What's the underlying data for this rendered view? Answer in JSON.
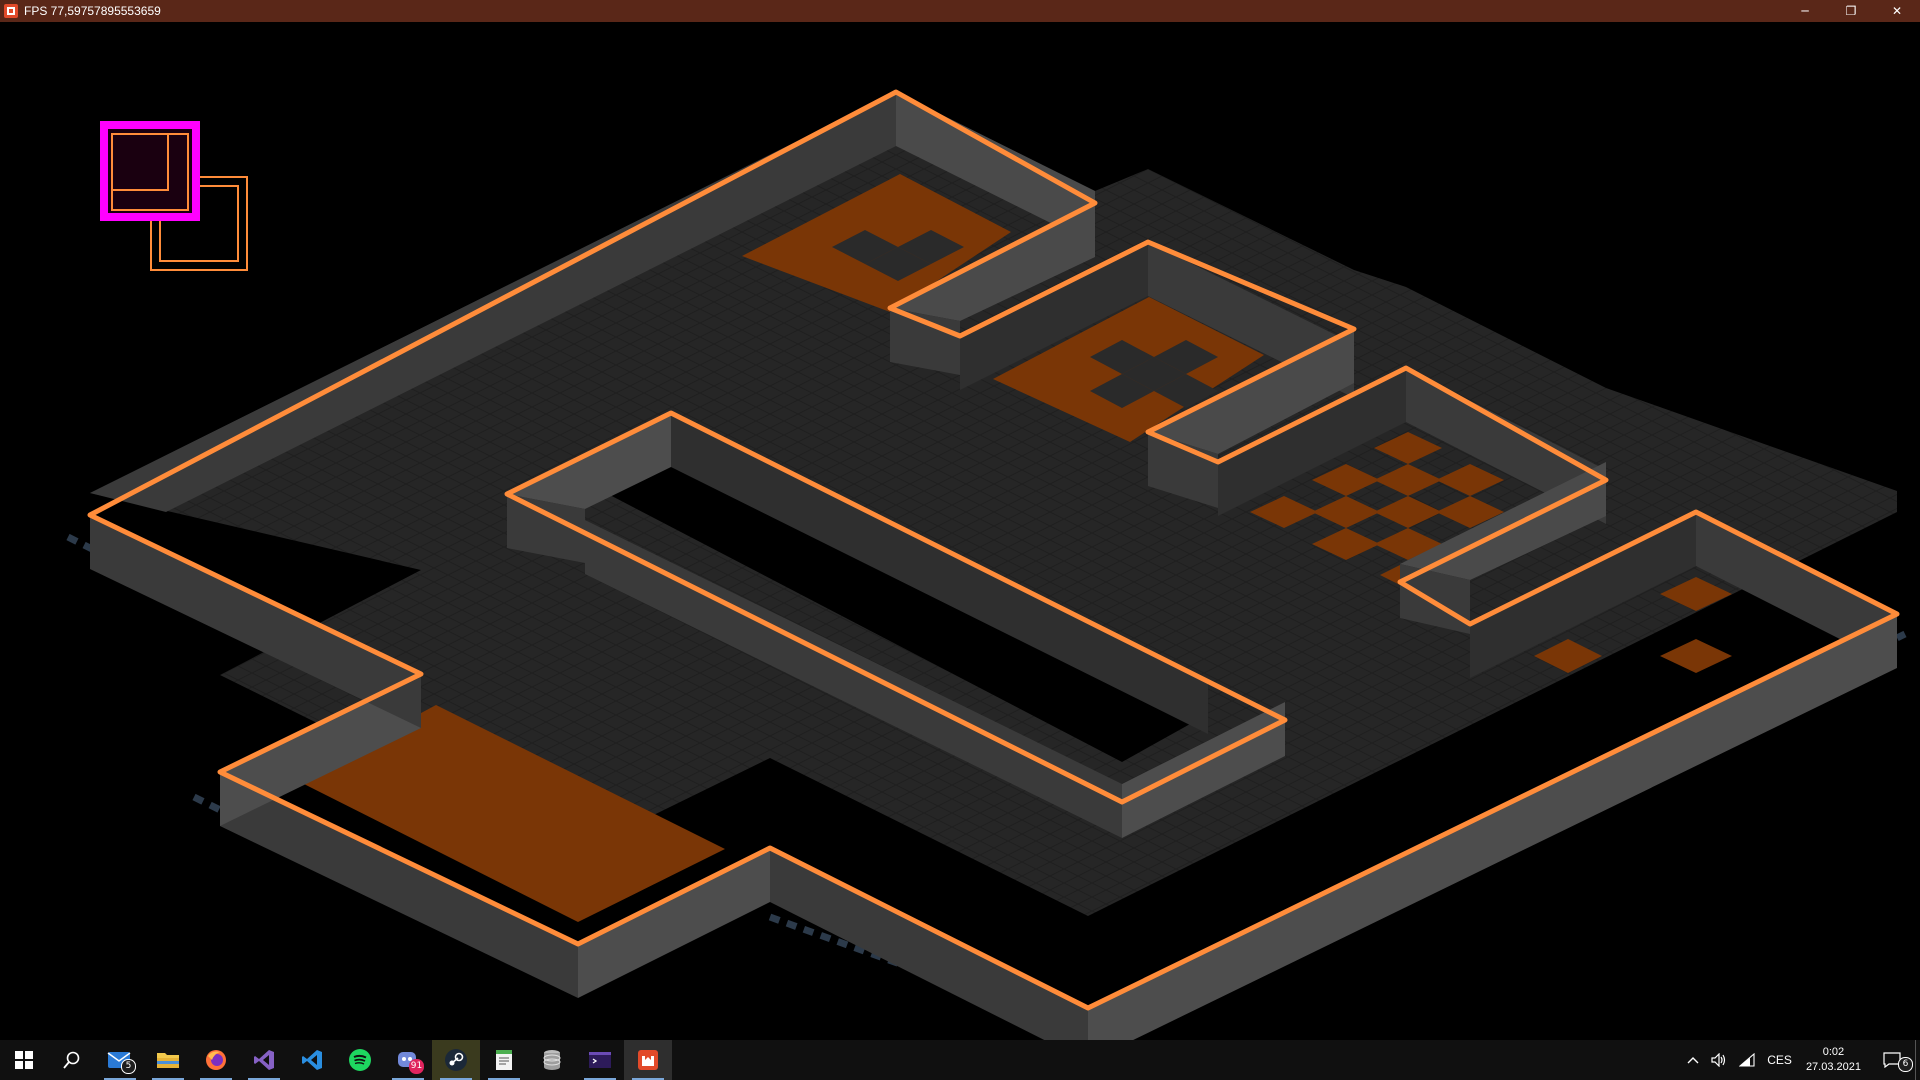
{
  "window": {
    "title": "FPS 77,59757895553659",
    "minimize_glyph": "─",
    "restore_glyph": "❐",
    "close_glyph": "✕"
  },
  "colors": {
    "titlebar": "#5a2718",
    "outline": "#ff8c3a",
    "floor": "#262626",
    "wall_front": "#4d4d4d",
    "wall_side": "#3a3a3a",
    "brown_tile": "#7a3606",
    "selector": "#ff00ff"
  },
  "taskbar": {
    "apps": [
      {
        "name": "start-button",
        "icon": "windows-icon"
      },
      {
        "name": "search-button",
        "icon": "search-icon"
      },
      {
        "name": "mail-app",
        "icon": "mail-icon",
        "badge": "5"
      },
      {
        "name": "file-explorer-app",
        "icon": "folder-icon"
      },
      {
        "name": "firefox-app",
        "icon": "firefox-icon"
      },
      {
        "name": "visual-studio-app",
        "icon": "visual-studio-icon"
      },
      {
        "name": "vscode-app",
        "icon": "vscode-icon"
      },
      {
        "name": "spotify-app",
        "icon": "spotify-icon"
      },
      {
        "name": "discord-app",
        "icon": "discord-icon",
        "badge": "91"
      },
      {
        "name": "steam-app",
        "icon": "steam-icon"
      },
      {
        "name": "notepad-app",
        "icon": "notepad-icon"
      },
      {
        "name": "database-app",
        "icon": "database-icon"
      },
      {
        "name": "terminal-app",
        "icon": "terminal-icon"
      },
      {
        "name": "monogame-app",
        "icon": "monogame-icon"
      }
    ],
    "tray": {
      "language": "CES",
      "time": "0:02",
      "date": "27.03.2021",
      "notifications": "6"
    }
  }
}
